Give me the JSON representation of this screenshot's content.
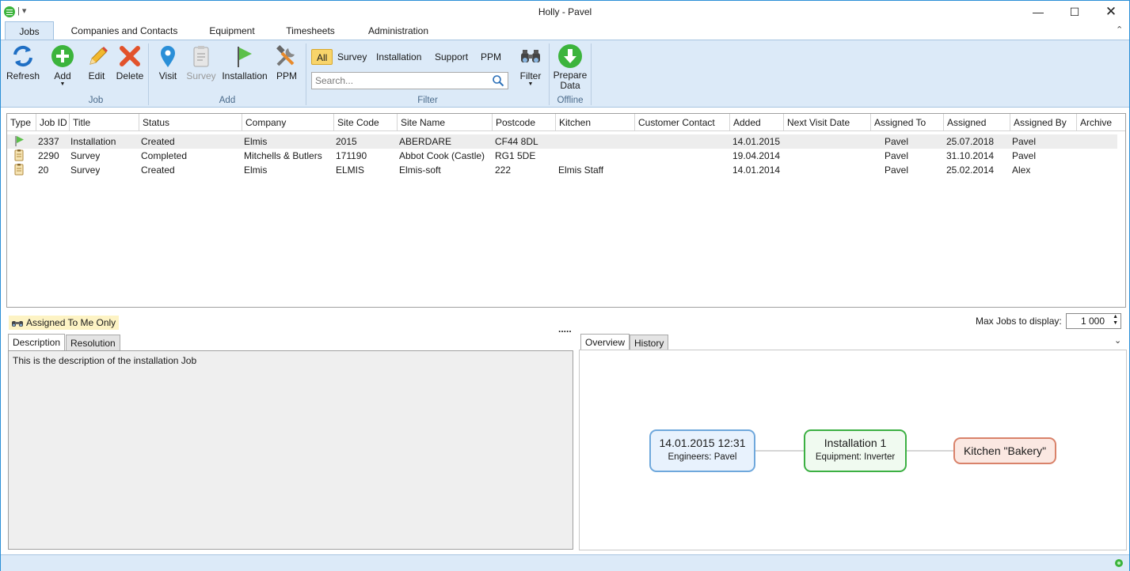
{
  "window": {
    "title": "Holly - Pavel",
    "qat": "| ▾"
  },
  "tabs": [
    "Jobs",
    "Companies and Contacts",
    "Equipment",
    "Timesheets",
    "Administration"
  ],
  "ribbon": {
    "job": {
      "refresh": "Refresh",
      "add": "Add",
      "edit": "Edit",
      "delete": "Delete",
      "group": "Job"
    },
    "add": {
      "visit": "Visit",
      "survey": "Survey",
      "installation": "Installation",
      "ppm": "PPM",
      "group": "Add"
    },
    "filter": {
      "all": "All",
      "survey": "Survey",
      "installation": "Installation",
      "support": "Support",
      "ppm": "PPM",
      "search_placeholder": "Search...",
      "filter": "Filter",
      "group": "Filter"
    },
    "offline": {
      "prepare_line1": "Prepare",
      "prepare_line2": "Data",
      "group": "Offline"
    }
  },
  "grid": {
    "columns": [
      "Type",
      "Job ID",
      "Title",
      "Status",
      "Company",
      "Site Code",
      "Site Name",
      "Postcode",
      "Kitchen",
      "Customer Contact",
      "Added",
      "Next Visit Date",
      "Assigned To",
      "Assigned",
      "Assigned By",
      "Archive"
    ],
    "rows": [
      {
        "type_icon": "flag-icon",
        "job_id": "2337",
        "title": "Installation",
        "status": "Created",
        "company": "Elmis",
        "site_code": "2015",
        "site_name": "ABERDARE",
        "postcode": "CF44 8DL",
        "kitchen": "",
        "customer_contact": "",
        "added": "14.01.2015",
        "next_visit": "",
        "assigned_to": "Pavel",
        "assigned": "25.07.2018",
        "assigned_by": "Pavel",
        "archive": ""
      },
      {
        "type_icon": "clipboard-icon",
        "job_id": "2290",
        "title": "Survey",
        "status": "Completed",
        "company": "Mitchells & Butlers",
        "site_code": "171190",
        "site_name": "Abbot Cook (Castle)",
        "postcode": "RG1 5DE",
        "kitchen": "",
        "customer_contact": "",
        "added": "19.04.2014",
        "next_visit": "",
        "assigned_to": "Pavel",
        "assigned": "31.10.2014",
        "assigned_by": "Pavel",
        "archive": ""
      },
      {
        "type_icon": "clipboard-icon",
        "job_id": "20",
        "title": "Survey",
        "status": "Created",
        "company": "Elmis",
        "site_code": "ELMIS",
        "site_name": "Elmis-soft",
        "postcode": "222",
        "kitchen": "Elmis Staff",
        "customer_contact": "",
        "added": "14.01.2014",
        "next_visit": "",
        "assigned_to": "Pavel",
        "assigned": "25.02.2014",
        "assigned_by": "Alex",
        "archive": ""
      }
    ]
  },
  "bottom": {
    "assigned_only": "Assigned To Me Only",
    "max_jobs_label": "Max Jobs to display:",
    "max_jobs_value": "1 000",
    "splitter": "....."
  },
  "left_panel": {
    "tabs": [
      "Description",
      "Resolution"
    ],
    "description": "This is the description of the installation Job"
  },
  "right_panel": {
    "tabs": [
      "Overview",
      "History"
    ],
    "nodes": [
      {
        "title": "14.01.2015 12:31",
        "sub": "Engineers: Pavel"
      },
      {
        "title": "Installation 1",
        "sub": "Equipment: Inverter"
      },
      {
        "title": "Kitchen \"Bakery\"",
        "sub": ""
      }
    ]
  },
  "colors": {
    "accent": "#2b8fd6",
    "ribbon_bg": "#dceaf8",
    "filter_selected": "#f8d46a",
    "node1": "#6fa8dc",
    "node2": "#3cb043",
    "node3": "#d9826a"
  }
}
